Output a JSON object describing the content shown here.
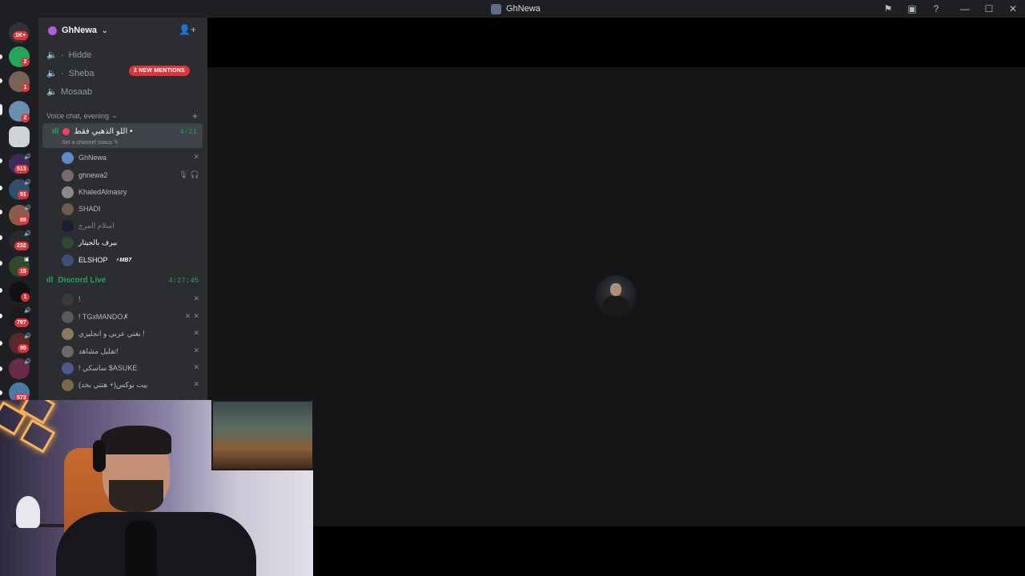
{
  "window": {
    "title": "GhNewa",
    "controls": [
      "inbox-icon",
      "screen-share-icon",
      "help-icon",
      "minimize-icon",
      "maximize-icon",
      "close-icon"
    ]
  },
  "server_rail": {
    "badges": [
      "1K+",
      "2",
      "1",
      "2",
      "",
      "513",
      "91",
      "89",
      "232",
      "15",
      "1",
      "797",
      "95",
      "",
      "573"
    ]
  },
  "guild": {
    "name": "GhNewa",
    "mentions_label": "2 NEW MENTIONS"
  },
  "channels": [
    {
      "name": "Hidde",
      "prefix": "·"
    },
    {
      "name": "Sheba",
      "prefix": "·"
    },
    {
      "name": "Mosaab",
      "prefix": ""
    }
  ],
  "voice_category": {
    "name": "Voice chat, evening"
  },
  "active_voice": {
    "name": "اللو الذهبي فقط •",
    "status": "Set a channel status",
    "timer": "4:21",
    "members": [
      {
        "name": "GhNewa",
        "color": "#5b8cc4"
      },
      {
        "name": "ghnewa2",
        "color": "#7a6a6a"
      },
      {
        "name": "KhaledAlmasry",
        "color": "#8a8a8a"
      },
      {
        "name": "SHADI",
        "color": "#6d5a4c"
      },
      {
        "name": "اسلام المرج",
        "color": "#1c1e2f"
      },
      {
        "name": "بيرف بالجيتار",
        "color": "#2f4a2f"
      },
      {
        "name": "ELSHOP",
        "color": "#3c4f7a",
        "tag": "⚡MB7"
      }
    ]
  },
  "discord_live": {
    "name": "Discord Live",
    "timer": "4:27:45",
    "members": [
      {
        "name": "!",
        "color": "#3a3a3a"
      },
      {
        "name": "! TGxMANDO✗",
        "color": "#5a5a5a"
      },
      {
        "name": "بغني عربي و انجليزي !",
        "color": "#8a7a5a"
      },
      {
        "name": "تقليل مشاهد!",
        "color": "#6a6a6a"
      },
      {
        "name": "! ساسكي $ASUKE",
        "color": "#4a5a8a"
      },
      {
        "name": "بيت بوكس(+ هتتي بخد)",
        "color": "#7a6a4a"
      }
    ]
  }
}
